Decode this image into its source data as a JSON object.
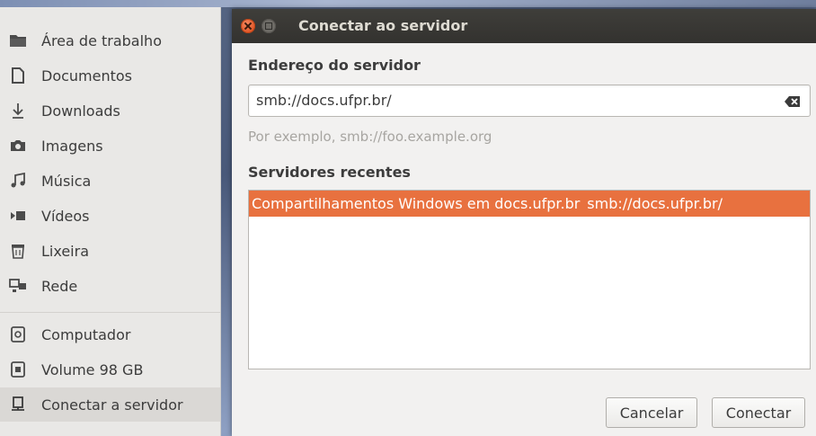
{
  "sidebar": {
    "items": [
      {
        "label": "Área de trabalho",
        "icon": "desktop-folder-icon"
      },
      {
        "label": "Documentos",
        "icon": "document-icon"
      },
      {
        "label": "Downloads",
        "icon": "download-icon"
      },
      {
        "label": "Imagens",
        "icon": "camera-icon"
      },
      {
        "label": "Música",
        "icon": "music-icon"
      },
      {
        "label": "Vídeos",
        "icon": "video-icon"
      },
      {
        "label": "Lixeira",
        "icon": "trash-icon"
      },
      {
        "label": "Rede",
        "icon": "network-icon"
      },
      {
        "label": "Computador",
        "icon": "computer-icon"
      },
      {
        "label": "Volume 98 GB",
        "icon": "drive-icon"
      },
      {
        "label": "Conectar a servidor",
        "icon": "server-icon"
      }
    ]
  },
  "dialog": {
    "title": "Conectar ao servidor",
    "address_label": "Endereço do servidor",
    "address_value": "smb://docs.ufpr.br/",
    "example_text": "Por exemplo, smb://foo.example.org",
    "recent_label": "Servidores recentes",
    "recent_servers": [
      {
        "name": "Compartilhamentos Windows em docs.ufpr.br",
        "uri": "smb://docs.ufpr.br/"
      }
    ],
    "cancel_label": "Cancelar",
    "connect_label": "Conectar"
  },
  "colors": {
    "selection": "#e8713f",
    "titlebar": "#3a3935",
    "close_button": "#e9582a"
  }
}
